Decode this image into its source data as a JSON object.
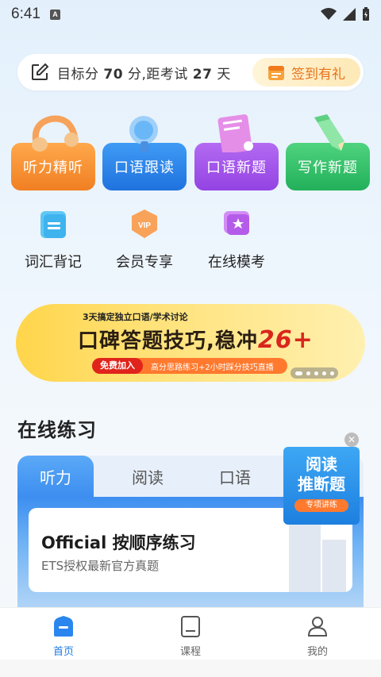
{
  "status_bar": {
    "time": "6:41",
    "badge": "A"
  },
  "target": {
    "prefix": "目标分 ",
    "score": "70",
    "mid": " 分,距考试 ",
    "days": "27",
    "suffix": " 天",
    "checkin_label": "签到有礼"
  },
  "big_cards": [
    {
      "label": "听力精听",
      "color": "#f7933a",
      "icon": "headphones-icon"
    },
    {
      "label": "口语跟读",
      "color": "#2f8cf0",
      "icon": "microphone-icon"
    },
    {
      "label": "口语新题",
      "color": "#a650ea",
      "icon": "notebook-icon"
    },
    {
      "label": "写作新题",
      "color": "#37c36a",
      "icon": "pencil-icon"
    }
  ],
  "small_items": [
    {
      "label": "词汇背记",
      "icon": "vocabulary-icon"
    },
    {
      "label": "会员专享",
      "icon": "vip-icon",
      "badge": "VIP"
    },
    {
      "label": "在线模考",
      "icon": "mock-exam-icon"
    }
  ],
  "banner": {
    "sub": "3天搞定独立口语/学术讨论",
    "headline": "口碑答题技巧,稳冲",
    "score": "26+",
    "tag": "免费加入",
    "desc": "高分思路练习+2小时踩分技巧直播"
  },
  "section_title": "在线练习",
  "practice": {
    "tabs": [
      "听力",
      "阅读",
      "口语"
    ],
    "card_title": "Official 按顺序练习",
    "card_subtitle": "ETS授权最新官方真题"
  },
  "float_ad": {
    "line1": "阅读",
    "line2": "推断题",
    "button": "专项讲练"
  },
  "bottom_nav": [
    {
      "label": "首页",
      "icon": "home-icon"
    },
    {
      "label": "课程",
      "icon": "course-icon"
    },
    {
      "label": "我的",
      "icon": "profile-icon"
    }
  ]
}
